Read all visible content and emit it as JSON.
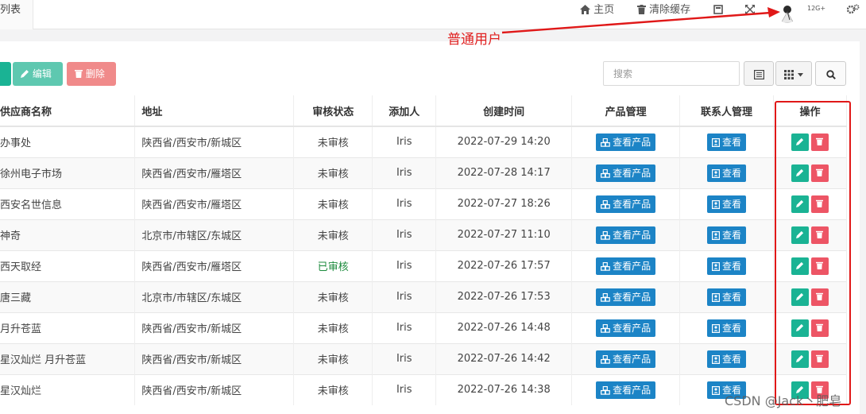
{
  "top_tab": "列表",
  "nav": {
    "home": "主页",
    "clear_cache": "清除缓存",
    "badge": "12G+"
  },
  "annotation": "普通用户",
  "toolbar": {
    "edit": "编辑",
    "delete": "删除",
    "search_placeholder": "搜索"
  },
  "table": {
    "headers": [
      "供应商名称",
      "地址",
      "审核状态",
      "添加人",
      "创建时间",
      "产品管理",
      "联系人管理",
      "操作"
    ],
    "view_products": "查看产品",
    "view": "查看",
    "rows": [
      {
        "name": "办事处",
        "address": "陕西省/西安市/新城区",
        "status": "未审核",
        "adder": "Iris",
        "time": "2022-07-29 14:20"
      },
      {
        "name": "徐州电子市场",
        "address": "陕西省/西安市/雁塔区",
        "status": "未审核",
        "adder": "Iris",
        "time": "2022-07-28 14:17"
      },
      {
        "name": "西安名世信息",
        "address": "陕西省/西安市/雁塔区",
        "status": "未审核",
        "adder": "Iris",
        "time": "2022-07-27 18:26"
      },
      {
        "name": "神奇",
        "address": "北京市/市辖区/东城区",
        "status": "未审核",
        "adder": "Iris",
        "time": "2022-07-27 11:10"
      },
      {
        "name": "西天取经",
        "address": "陕西省/西安市/雁塔区",
        "status": "已审核",
        "adder": "Iris",
        "time": "2022-07-26 17:57"
      },
      {
        "name": "唐三藏",
        "address": "北京市/市辖区/东城区",
        "status": "未审核",
        "adder": "Iris",
        "time": "2022-07-26 17:53"
      },
      {
        "name": "月升苍蓝",
        "address": "陕西省/西安市/新城区",
        "status": "未审核",
        "adder": "Iris",
        "time": "2022-07-26 14:48"
      },
      {
        "name": "星汉灿烂 月升苍蓝",
        "address": "陕西省/西安市/新城区",
        "status": "未审核",
        "adder": "Iris",
        "time": "2022-07-26 14:42"
      },
      {
        "name": "星汉灿烂",
        "address": "陕西省/西安市/新城区",
        "status": "未审核",
        "adder": "Iris",
        "time": "2022-07-26 14:38"
      }
    ]
  },
  "watermark": "CSDN @Jack丶肥皂",
  "colors": {
    "primary": "#1ab394",
    "danger": "#ed5565",
    "info": "#1c84c6",
    "annotation_red": "#e01818"
  }
}
